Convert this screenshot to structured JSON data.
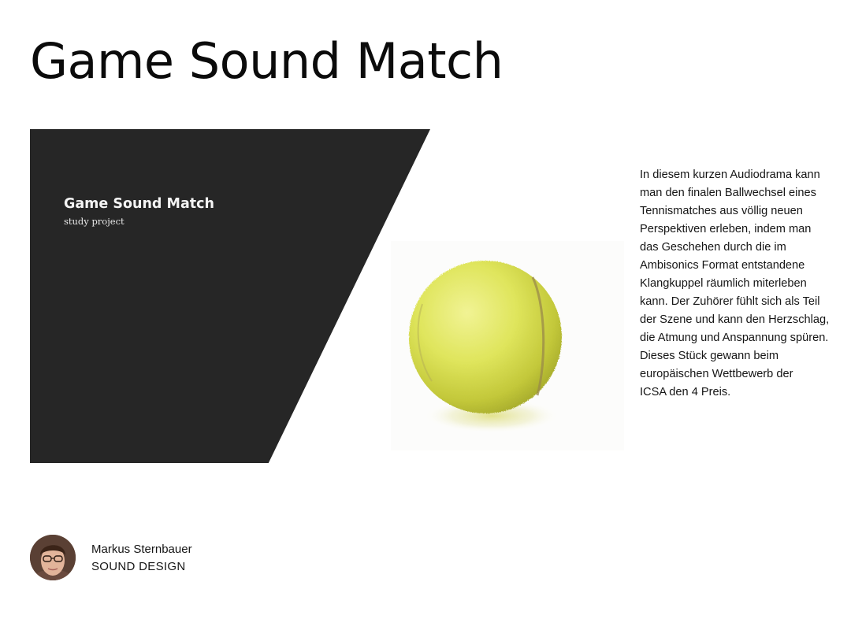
{
  "page": {
    "title": "Game Sound Match"
  },
  "hero": {
    "title": "Game Sound Match",
    "subtitle": "study project",
    "panel_color": "#262626",
    "image_icon": "tennis-ball-icon"
  },
  "description": {
    "text": "In diesem kurzen Audiodrama kann\nman den finalen Ballwechsel eines\nTennismatches aus völlig neuen\nPerspektiven erleben, indem man\ndas Geschehen durch die im\nAmbisonics Format entstandene\nKlangkuppel räumlich miterleben\nkann. Der Zuhörer fühlt sich als Teil\nder Szene und kann den Herzschlag,\ndie Atmung und Anspannung spüren.\nDieses Stück gewann beim\neuropäischen Wettbewerb der\nICSA den 4 Preis."
  },
  "author": {
    "name": "Markus Sternbauer",
    "role": "SOUND DESIGN",
    "avatar_icon": "avatar-portrait-icon"
  }
}
